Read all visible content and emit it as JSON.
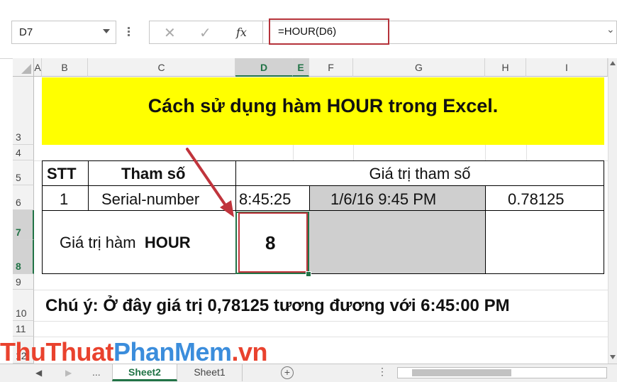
{
  "formula_bar": {
    "name_box": "D7",
    "cancel_glyph": "✕",
    "enter_glyph": "✓",
    "fx_label": "fx",
    "formula": "=HOUR(D6)"
  },
  "columns": [
    "A",
    "B",
    "C",
    "D",
    "E",
    "F",
    "G",
    "H",
    "I"
  ],
  "rows": [
    "3",
    "4",
    "5",
    "6",
    "7",
    "8",
    "9",
    "10",
    "11",
    "12"
  ],
  "title": "Cách sử dụng hàm HOUR trong Excel.",
  "table": {
    "hdr_stt": "STT",
    "hdr_param": "Tham số",
    "hdr_value": "Giá trị tham số",
    "row_stt": "1",
    "row_param": "Serial-number",
    "val1": "8:45:25",
    "val2": "1/6/16 9:45 PM",
    "val3": "0.78125",
    "result_label_pre": "Giá trị hàm",
    "result_label_fn": "HOUR",
    "result_value": "8"
  },
  "note": "Chú ý: Ở đây giá trị 0,78125 tương đương với 6:45:00 PM",
  "watermark": {
    "part1": "ThuThuat",
    "part2": "PhanMem",
    "part3": ".vn"
  },
  "tabs": {
    "ellipsis": "...",
    "sheet2": "Sheet2",
    "sheet1": "Sheet1",
    "add": "+"
  },
  "colors": {
    "excel_green": "#217346",
    "highlight_red": "#c0343c",
    "title_yellow": "#ffff00"
  },
  "icons": [
    "dropdown-arrow-icon",
    "cancel-icon",
    "enter-icon",
    "fx-icon",
    "expand-formula-icon",
    "scroll-left-icon",
    "scroll-right-icon",
    "add-sheet-icon"
  ]
}
